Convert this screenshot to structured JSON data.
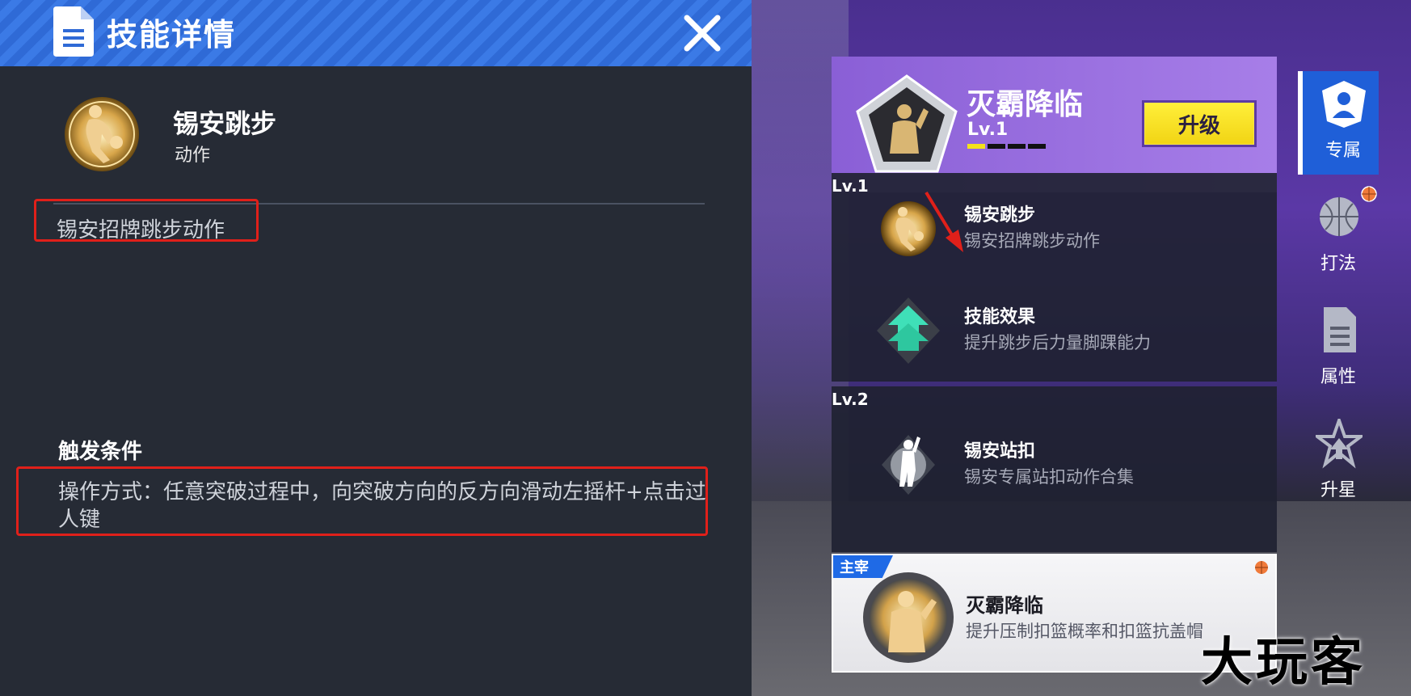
{
  "detail": {
    "header_title": "技能详情",
    "close_label": "✕",
    "skill_name": "锡安跳步",
    "skill_type": "动作",
    "skill_desc": "锡安招牌跳步动作",
    "trigger_title": "触发条件",
    "trigger_text": "操作方式：任意突破过程中，向突破方向的反方向滑动左摇杆+点击过人键"
  },
  "ult": {
    "name": "灭霸降临",
    "level": "Lv.1",
    "level_progress": 0.25,
    "upgrade_label": "升级"
  },
  "levels": [
    {
      "label": "Lv.1",
      "skills": [
        {
          "title": "锡安跳步",
          "desc": "锡安招牌跳步动作",
          "icon": "player-move-icon"
        },
        {
          "title": "技能效果",
          "desc": "提升跳步后力量脚踝能力",
          "icon": "upgrade-arrow-icon"
        }
      ]
    },
    {
      "label": "Lv.2",
      "skills": [
        {
          "title": "锡安站扣",
          "desc": "锡安专属站扣动作合集",
          "icon": "dunk-icon"
        }
      ]
    }
  ],
  "master": {
    "tag": "主宰",
    "title": "灭霸降临",
    "desc": "提升压制扣篮概率和扣篮抗盖帽"
  },
  "tabs": [
    {
      "label": "专属",
      "icon": "exclusive-icon",
      "active": true
    },
    {
      "label": "打法",
      "icon": "playstyle-icon",
      "active": false
    },
    {
      "label": "属性",
      "icon": "document-icon",
      "active": false
    },
    {
      "label": "升星",
      "icon": "star-up-icon",
      "active": false
    }
  ],
  "watermark": "大玩客",
  "colors": {
    "header_blue": "#2f6ad6",
    "highlight_red": "#e0201a",
    "upgrade_yellow": "#f1d414",
    "card_purple": "#a77ee8",
    "tab_active": "#1f5fd8"
  }
}
